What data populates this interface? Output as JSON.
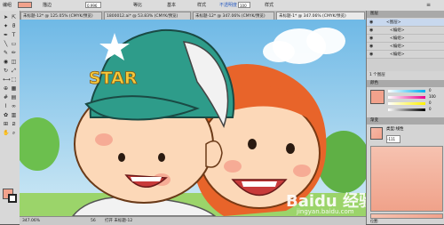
{
  "control_bar": {
    "label_object": "编组",
    "label_stroke": "描边",
    "stroke_width": "0.996",
    "stroke_style": "等比",
    "basic": "基本",
    "opacity_label": "不透明度",
    "opacity_value": "100",
    "style_label": "样式"
  },
  "tabs": [
    {
      "label": "未标题-12* @ 125.05% (CMYK/预览)"
    },
    {
      "label": "1800012.ai* @ 53.83% (CMYK/预览)"
    },
    {
      "label": "未标题-12* @ 347.06% (CMYK/预览)"
    },
    {
      "label": "未标题-1* @ 347.06% (CMYK/预览)"
    }
  ],
  "status": {
    "zoom": "347.06%",
    "page": "56",
    "info": "打开 未标题-12"
  },
  "panels": {
    "layers_title": "图层",
    "layers_count": "1 个图层",
    "layers": [
      {
        "name": "<图层>"
      },
      {
        "name": "<编组>"
      },
      {
        "name": "<编组>"
      },
      {
        "name": "<编组>"
      },
      {
        "name": "<编组>"
      }
    ],
    "color_title": "颜色",
    "gradient_title": "渐变",
    "gradient_type": "类型:线性",
    "angle": "-111",
    "location": "位置:",
    "color_values": [
      "0",
      "100",
      "0",
      "0"
    ],
    "color_swatch": "#f2a28c"
  },
  "colors": {
    "sky": "#8ec8e8",
    "cap_green": "#2e9c8a",
    "skin": "#fcd8b8",
    "hair_orange": "#e8642a",
    "fill_swatch": "#f2a28c"
  },
  "watermark": {
    "brand": "Baidu 经验",
    "url": "jingyan.baidu.com"
  }
}
